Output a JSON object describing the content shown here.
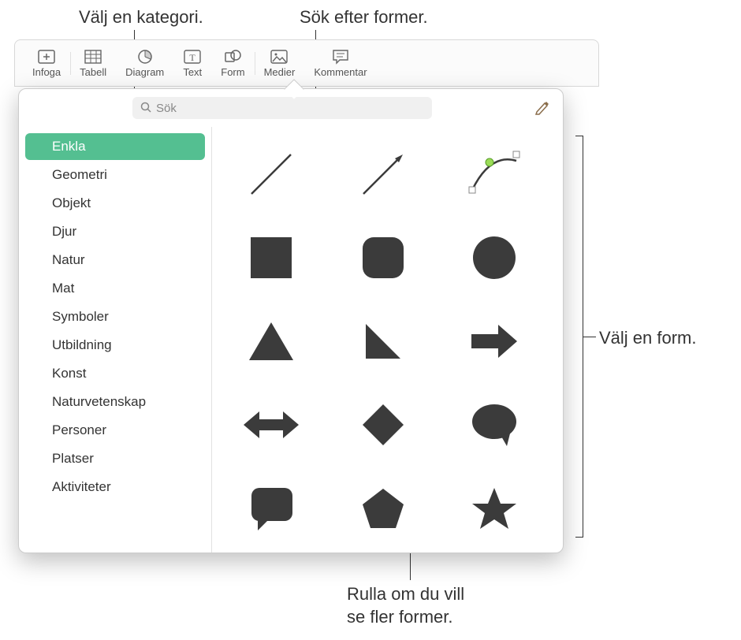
{
  "callouts": {
    "category": "Välj en kategori.",
    "search": "Sök efter former.",
    "choose_shape": "Välj en form.",
    "scroll": "Rulla om du vill\nse fler former."
  },
  "toolbar": {
    "items": [
      {
        "label": "Infoga",
        "icon": "insert-icon"
      },
      {
        "label": "Tabell",
        "icon": "table-icon"
      },
      {
        "label": "Diagram",
        "icon": "chart-icon"
      },
      {
        "label": "Text",
        "icon": "text-icon"
      },
      {
        "label": "Form",
        "icon": "shape-icon"
      },
      {
        "label": "Medier",
        "icon": "media-icon"
      },
      {
        "label": "Kommentar",
        "icon": "comment-icon"
      }
    ]
  },
  "search": {
    "placeholder": "Sök"
  },
  "sidebar": {
    "items": [
      {
        "label": "Enkla",
        "selected": true
      },
      {
        "label": "Geometri"
      },
      {
        "label": "Objekt"
      },
      {
        "label": "Djur"
      },
      {
        "label": "Natur"
      },
      {
        "label": "Mat"
      },
      {
        "label": "Symboler"
      },
      {
        "label": "Utbildning"
      },
      {
        "label": "Konst"
      },
      {
        "label": "Naturvetenskap"
      },
      {
        "label": "Personer"
      },
      {
        "label": "Platser"
      },
      {
        "label": "Aktiviteter"
      }
    ]
  },
  "shapes": [
    {
      "name": "line",
      "label": "Line"
    },
    {
      "name": "arrow-line",
      "label": "Arrow line"
    },
    {
      "name": "curve",
      "label": "Curve"
    },
    {
      "name": "square",
      "label": "Square"
    },
    {
      "name": "rounded-square",
      "label": "Rounded square"
    },
    {
      "name": "circle",
      "label": "Circle"
    },
    {
      "name": "triangle",
      "label": "Triangle"
    },
    {
      "name": "right-triangle",
      "label": "Right triangle"
    },
    {
      "name": "arrow-right",
      "label": "Arrow right"
    },
    {
      "name": "arrow-bidir",
      "label": "Bidirectional arrow"
    },
    {
      "name": "diamond",
      "label": "Diamond"
    },
    {
      "name": "speech-bubble",
      "label": "Speech bubble"
    },
    {
      "name": "callout-rect",
      "label": "Callout rectangle"
    },
    {
      "name": "pentagon",
      "label": "Pentagon"
    },
    {
      "name": "star",
      "label": "Star"
    }
  ]
}
